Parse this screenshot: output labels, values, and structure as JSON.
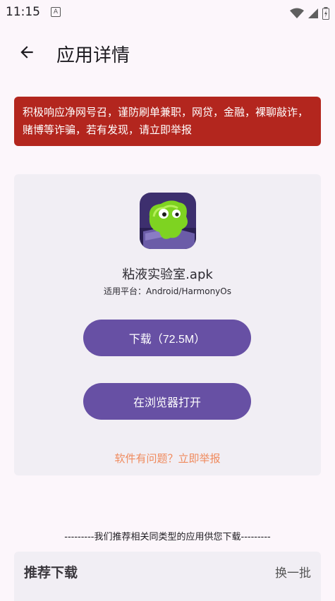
{
  "status_bar": {
    "time": "11:15",
    "notification_icon": "A"
  },
  "app_bar": {
    "title": "应用详情"
  },
  "warning": {
    "text": "积极响应净网号召，谨防刷单兼职，网贷，金融，裸聊敲诈，赌博等诈骗，若有发现，请立即举报"
  },
  "app": {
    "name": "粘液实验室.apk",
    "platform": "适用平台：Android/HarmonyOs",
    "download_label": "下载（72.5M）",
    "browser_label": "在浏览器打开",
    "report_label": "软件有问题？立即举报"
  },
  "recommend": {
    "divider": "---------我们推荐相关同类型的应用供您下载---------",
    "title": "推荐下载",
    "refresh_label": "换一批"
  },
  "colors": {
    "primary": "#6750a4",
    "warning_bg": "#b3261e",
    "report_link": "#f08a5d",
    "background": "#fcf6fb",
    "card": "#f1eef4"
  }
}
